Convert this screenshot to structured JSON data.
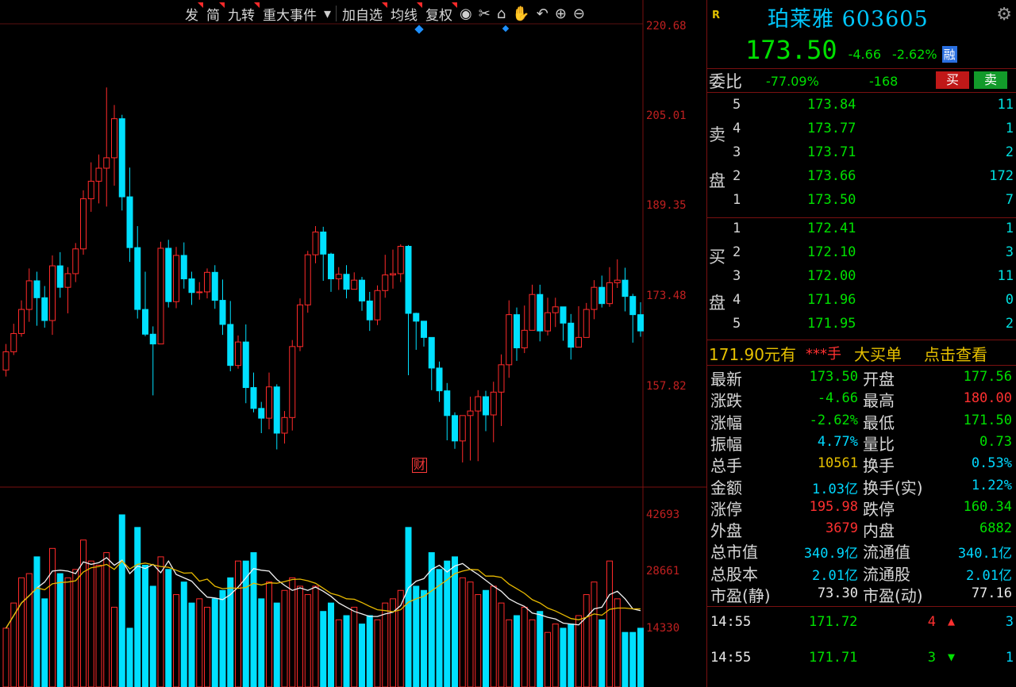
{
  "toolbar": {
    "buttons": [
      "发",
      "简",
      "九转",
      "重大事件",
      "加自选",
      "均线",
      "复权"
    ],
    "icons": [
      "eye-icon",
      "scissors-icon",
      "lock-icon",
      "hand-icon",
      "undo-icon",
      "zoom-in-icon",
      "zoom-out-icon"
    ]
  },
  "axis": {
    "price_labels": [
      "220.68",
      "205.01",
      "189.35",
      "173.48",
      "157.82"
    ],
    "volume_labels": [
      "42693",
      "28661",
      "14330"
    ]
  },
  "chart_data": {
    "type": "candlestick",
    "price_range": [
      150,
      220.68
    ],
    "volume_range": [
      0,
      42693
    ],
    "candles": [
      [
        167.5,
        170.3,
        171.5,
        166.5,
        14000
      ],
      [
        170.3,
        173.1,
        174.6,
        169.8,
        20000
      ],
      [
        173.1,
        176.8,
        178.2,
        172.6,
        26000
      ],
      [
        176.8,
        181.2,
        183.1,
        174.9,
        27000
      ],
      [
        181.2,
        178.6,
        182.6,
        174.3,
        31000
      ],
      [
        178.6,
        175.1,
        180.4,
        174.0,
        21000
      ],
      [
        175.1,
        183.5,
        185.1,
        172.9,
        33000
      ],
      [
        183.5,
        180.2,
        185.6,
        178.6,
        27000
      ],
      [
        180.2,
        182.3,
        183.3,
        176.2,
        26000
      ],
      [
        182.3,
        186.1,
        187.0,
        181.0,
        28000
      ],
      [
        186.1,
        193.8,
        195.1,
        185.2,
        35000
      ],
      [
        193.8,
        196.5,
        199.4,
        191.8,
        30000
      ],
      [
        196.5,
        198.5,
        200.6,
        193.1,
        29000
      ],
      [
        198.5,
        200.1,
        210.9,
        192.6,
        32000
      ],
      [
        200.1,
        206.1,
        208.2,
        195.8,
        19000
      ],
      [
        206.1,
        194.1,
        206.7,
        192.0,
        41000
      ],
      [
        194.1,
        186.3,
        198.6,
        184.1,
        14000
      ],
      [
        186.3,
        176.8,
        189.6,
        175.4,
        38000
      ],
      [
        176.8,
        173.0,
        182.6,
        172.7,
        29000
      ],
      [
        173.0,
        171.5,
        174.2,
        163.6,
        24000
      ],
      [
        171.5,
        186.2,
        187.2,
        171.5,
        31000
      ],
      [
        186.2,
        178.0,
        187.5,
        177.1,
        28000
      ],
      [
        178.0,
        185.1,
        186.4,
        177.0,
        22000
      ],
      [
        185.1,
        181.5,
        187.1,
        180.0,
        25000
      ],
      [
        181.5,
        179.4,
        182.6,
        177.5,
        20000
      ],
      [
        179.4,
        179.5,
        181.0,
        178.3,
        21000
      ],
      [
        179.5,
        182.5,
        183.1,
        178.5,
        19000
      ],
      [
        182.5,
        178.2,
        183.6,
        176.9,
        21000
      ],
      [
        178.2,
        174.5,
        181.4,
        172.9,
        23000
      ],
      [
        174.5,
        168.2,
        178.1,
        167.3,
        26000
      ],
      [
        168.2,
        171.8,
        172.8,
        167.7,
        30000
      ],
      [
        171.8,
        164.8,
        174.5,
        162.4,
        30000
      ],
      [
        164.8,
        161.6,
        167.1,
        161.0,
        32000
      ],
      [
        161.6,
        160.1,
        162.6,
        157.8,
        21000
      ],
      [
        160.1,
        164.9,
        167.1,
        158.4,
        25000
      ],
      [
        164.9,
        157.8,
        165.3,
        155.3,
        20000
      ],
      [
        157.8,
        160.2,
        161.2,
        156.2,
        23000
      ],
      [
        160.2,
        171.1,
        172.1,
        158.2,
        26000
      ],
      [
        171.1,
        177.5,
        178.5,
        170.4,
        24000
      ],
      [
        177.5,
        185.2,
        185.8,
        176.3,
        22000
      ],
      [
        185.2,
        188.7,
        189.6,
        183.9,
        24000
      ],
      [
        188.7,
        185.3,
        189.5,
        181.2,
        18000
      ],
      [
        185.3,
        181.5,
        185.5,
        179.5,
        20000
      ],
      [
        181.5,
        182.2,
        183.3,
        179.8,
        16000
      ],
      [
        182.2,
        179.9,
        183.6,
        178.5,
        17000
      ],
      [
        179.9,
        181.3,
        182.5,
        180.0,
        19000
      ],
      [
        181.3,
        178.1,
        181.8,
        176.6,
        15000
      ],
      [
        178.1,
        175.2,
        179.5,
        173.5,
        17000
      ],
      [
        175.2,
        179.7,
        180.5,
        174.4,
        16000
      ],
      [
        179.7,
        182.1,
        185.2,
        178.6,
        20000
      ],
      [
        182.1,
        182.3,
        186.0,
        180.0,
        21000
      ],
      [
        182.3,
        186.5,
        186.8,
        181.0,
        23000
      ],
      [
        186.5,
        176.2,
        186.7,
        166.7,
        38000
      ],
      [
        176.2,
        175.0,
        176.3,
        170.6,
        24000
      ],
      [
        175.0,
        172.5,
        174.8,
        171.1,
        23000
      ],
      [
        172.5,
        167.8,
        171.9,
        164.4,
        32000
      ],
      [
        167.8,
        164.3,
        168.8,
        162.6,
        28000
      ],
      [
        164.3,
        160.5,
        165.5,
        156.7,
        30000
      ],
      [
        160.5,
        156.6,
        161.0,
        155.4,
        31000
      ],
      [
        156.6,
        160.5,
        160.5,
        153.3,
        26000
      ],
      [
        160.5,
        161.2,
        163.4,
        153.6,
        25000
      ],
      [
        161.2,
        163.4,
        164.4,
        153.5,
        22000
      ],
      [
        163.4,
        160.6,
        164.3,
        158.1,
        23000
      ],
      [
        160.6,
        164.1,
        165.7,
        156.4,
        24000
      ],
      [
        164.1,
        168.3,
        169.9,
        158.9,
        20000
      ],
      [
        168.3,
        176.0,
        178.2,
        166.3,
        16000
      ],
      [
        176.0,
        170.9,
        177.1,
        168.9,
        17000
      ],
      [
        170.9,
        173.6,
        177.4,
        170.1,
        19000
      ],
      [
        173.6,
        179.1,
        180.6,
        174.2,
        16000
      ],
      [
        179.1,
        173.5,
        180.6,
        171.9,
        18000
      ],
      [
        173.5,
        176.3,
        178.6,
        172.8,
        13000
      ],
      [
        176.3,
        177.2,
        178.6,
        174.1,
        15000
      ],
      [
        177.2,
        174.7,
        175.6,
        172.0,
        14000
      ],
      [
        174.7,
        171.0,
        176.1,
        169.1,
        15000
      ],
      [
        171.0,
        172.5,
        177.3,
        171.8,
        17000
      ],
      [
        172.5,
        176.8,
        177.8,
        173.4,
        22000
      ],
      [
        176.8,
        180.2,
        181.3,
        175.3,
        25000
      ],
      [
        180.2,
        177.7,
        182.0,
        177.1,
        16000
      ],
      [
        177.7,
        180.9,
        183.3,
        177.2,
        30000
      ],
      [
        180.9,
        181.3,
        184.5,
        180.1,
        21000
      ],
      [
        181.3,
        178.8,
        183.2,
        176.5,
        13000
      ],
      [
        178.8,
        176.0,
        179.2,
        171.7,
        13000
      ],
      [
        176.0,
        173.5,
        177.9,
        172.6,
        14000
      ]
    ]
  },
  "stock": {
    "badge": "R",
    "name": "珀莱雅 603605",
    "price": "173.50",
    "change": "-4.66",
    "change_pct": "-2.62%",
    "rong": "融"
  },
  "weibi": {
    "label": "委比",
    "pct": "-77.09%",
    "diff": "-168",
    "buy": "买",
    "sell": "卖"
  },
  "sell_side": {
    "char1": "卖",
    "char2": "盘"
  },
  "buy_side": {
    "char1": "买",
    "char2": "盘"
  },
  "asks": [
    {
      "level": "5",
      "price": "173.84",
      "vol": "11"
    },
    {
      "level": "4",
      "price": "173.77",
      "vol": "1"
    },
    {
      "level": "3",
      "price": "173.71",
      "vol": "2"
    },
    {
      "level": "2",
      "price": "173.66",
      "vol": "172"
    },
    {
      "level": "1",
      "price": "173.50",
      "vol": "7"
    }
  ],
  "bids": [
    {
      "level": "1",
      "price": "172.41",
      "vol": "1"
    },
    {
      "level": "2",
      "price": "172.10",
      "vol": "3"
    },
    {
      "level": "3",
      "price": "172.00",
      "vol": "11"
    },
    {
      "level": "4",
      "price": "171.96",
      "vol": "0"
    },
    {
      "level": "5",
      "price": "171.95",
      "vol": "2"
    }
  ],
  "big_order": {
    "price_text": "171.90元有",
    "hand_text": "***手",
    "label": "大买单",
    "link": "点击查看"
  },
  "stats": [
    {
      "l1": "最新",
      "v1": "173.50",
      "c1": "green",
      "l2": "开盘",
      "v2": "177.56",
      "c2": "green"
    },
    {
      "l1": "涨跌",
      "v1": "-4.66",
      "c1": "green",
      "l2": "最高",
      "v2": "180.00",
      "c2": "red"
    },
    {
      "l1": "涨幅",
      "v1": "-2.62%",
      "c1": "green",
      "l2": "最低",
      "v2": "171.50",
      "c2": "green"
    },
    {
      "l1": "振幅",
      "v1": "4.77%",
      "c1": "cyan",
      "l2": "量比",
      "v2": "0.73",
      "c2": "green"
    },
    {
      "l1": "总手",
      "v1": "10561",
      "c1": "yellow",
      "l2": "换手",
      "v2": "0.53%",
      "c2": "cyan"
    },
    {
      "l1": "金额",
      "v1": "1.03亿",
      "c1": "cyan",
      "l2": "换手(实)",
      "v2": "1.22%",
      "c2": "cyan"
    },
    {
      "l1": "涨停",
      "v1": "195.98",
      "c1": "red",
      "l2": "跌停",
      "v2": "160.34",
      "c2": "green"
    },
    {
      "l1": "外盘",
      "v1": "3679",
      "c1": "red",
      "l2": "内盘",
      "v2": "6882",
      "c2": "green"
    },
    {
      "l1": "总市值",
      "v1": "340.9亿",
      "c1": "cyan",
      "l2": "流通值",
      "v2": "340.1亿",
      "c2": "cyan"
    },
    {
      "l1": "总股本",
      "v1": "2.01亿",
      "c1": "cyan",
      "l2": "流通股",
      "v2": "2.01亿",
      "c2": "cyan"
    },
    {
      "l1": "市盈(静)",
      "v1": "73.30",
      "c1": "white",
      "l2": "市盈(动)",
      "v2": "77.16",
      "c2": "white"
    }
  ],
  "ticks": [
    {
      "time": "14:55",
      "price": "171.72",
      "vol": "4",
      "dir": "up",
      "count": "3"
    },
    {
      "time": "14:55",
      "price": "171.71",
      "vol": "3",
      "dir": "down",
      "count": "1"
    }
  ],
  "colors": {
    "up": "#ff2a2a",
    "down": "#00e0ff",
    "ma_white": "#f0f0f0",
    "ma_yellow": "#e6b800",
    "grid": "#7a1010"
  }
}
